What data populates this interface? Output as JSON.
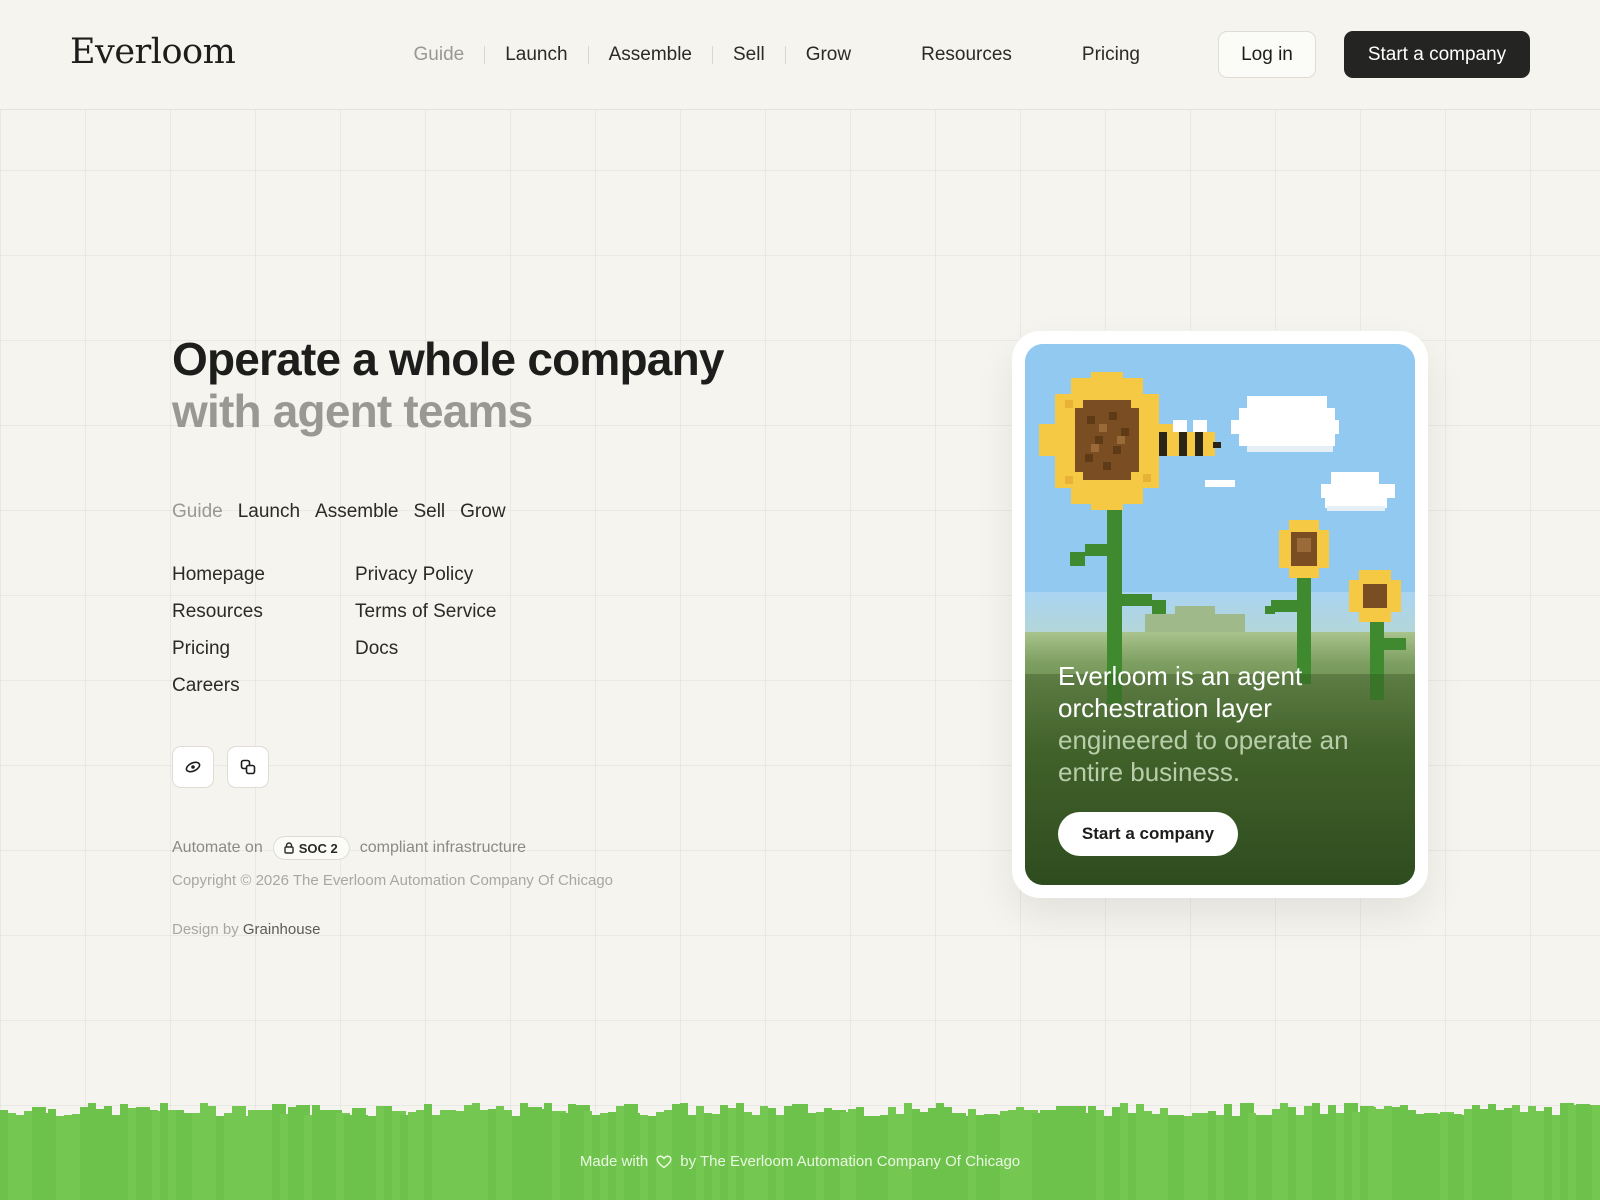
{
  "brand": {
    "name": "Everloom"
  },
  "nav": {
    "items": [
      {
        "label": "Guide",
        "muted": true
      },
      {
        "label": "Launch"
      },
      {
        "label": "Assemble"
      },
      {
        "label": "Sell"
      },
      {
        "label": "Grow"
      },
      {
        "label": "Resources"
      },
      {
        "label": "Pricing"
      }
    ],
    "login_label": "Log in",
    "start_label": "Start a company"
  },
  "hero": {
    "title_line1": "Operate a whole company",
    "title_line2": "with agent teams"
  },
  "subnav": [
    "Guide",
    "Launch",
    "Assemble",
    "Sell",
    "Grow"
  ],
  "links": {
    "col1": [
      "Homepage",
      "Resources",
      "Pricing",
      "Careers"
    ],
    "col2": [
      "Privacy Policy",
      "Terms of Service",
      "Docs"
    ]
  },
  "social": [
    "link-icon",
    "copy-icon"
  ],
  "compliance": {
    "prefix": "Automate on",
    "badge": "SOC 2",
    "suffix": "compliant infrastructure"
  },
  "copyright": "Copyright © 2026 The Everloom Automation Company Of Chicago",
  "design": {
    "prefix": "Design by",
    "studio": "Grainhouse"
  },
  "card": {
    "headline_white_1": "Everloom is an agent",
    "headline_white_2": "orchestration layer",
    "headline_green_1": "engineered to operate an",
    "headline_green_2": "entire business.",
    "button_label": "Start a company"
  },
  "footer": {
    "made_with": "Made with",
    "by": "by The Everloom Automation Company Of Chicago"
  },
  "colors": {
    "background": "#f5f4ef",
    "primary_button": "#242422",
    "grass": "#6cc24a",
    "sky": "#92c9f0"
  }
}
